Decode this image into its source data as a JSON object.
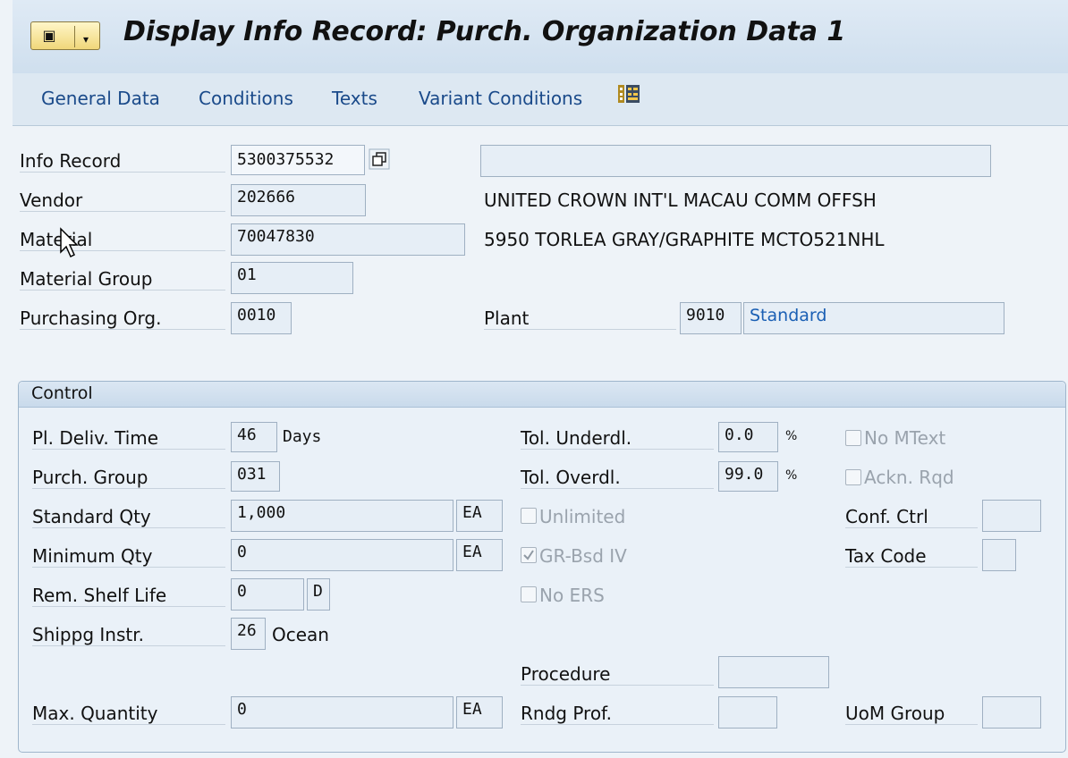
{
  "title": "Display Info Record: Purch. Organization Data 1",
  "toolbar": {
    "items": [
      "General Data",
      "Conditions",
      "Texts",
      "Variant Conditions"
    ],
    "icon": "overview-grid-icon"
  },
  "header": {
    "info_record": {
      "label": "Info Record",
      "value": "5300375532"
    },
    "vendor": {
      "label": "Vendor",
      "value": "202666",
      "name": "UNITED CROWN INT'L MACAU COMM OFFSH"
    },
    "material": {
      "label": "Material",
      "value": "70047830",
      "description": "5950 TORLEA GRAY/GRAPHITE MCTO521NHL"
    },
    "material_group": {
      "label": "Material Group",
      "value": "01"
    },
    "purchasing_org": {
      "label": "Purchasing Org.",
      "value": "0010"
    },
    "plant": {
      "label": "Plant",
      "value": "9010",
      "name": "Standard"
    }
  },
  "control": {
    "title": "Control",
    "pl_deliv_time": {
      "label": "Pl. Deliv. Time",
      "value": "46",
      "unit": "Days"
    },
    "purch_group": {
      "label": "Purch. Group",
      "value": "031"
    },
    "standard_qty": {
      "label": "Standard Qty",
      "value": "1,000",
      "unit": "EA"
    },
    "minimum_qty": {
      "label": "Minimum Qty",
      "value": "0",
      "unit": "EA"
    },
    "rem_shelf_life": {
      "label": "Rem. Shelf Life",
      "value": "0",
      "unit": "D"
    },
    "shippg_instr": {
      "label": "Shippg Instr.",
      "value": "26",
      "text": "Ocean"
    },
    "max_quantity": {
      "label": "Max. Quantity",
      "value": "0",
      "unit": "EA"
    },
    "tol_underdl": {
      "label": "Tol. Underdl.",
      "value": "0.0",
      "unit": "%"
    },
    "tol_overdl": {
      "label": "Tol. Overdl.",
      "value": "99.0",
      "unit": "%"
    },
    "unlimited": {
      "label": "Unlimited",
      "checked": false
    },
    "gr_bsd_iv": {
      "label": "GR-Bsd IV",
      "checked": true
    },
    "no_ers": {
      "label": "No ERS",
      "checked": false
    },
    "no_mtext": {
      "label": "No MText",
      "checked": false
    },
    "ackn_rqd": {
      "label": "Ackn. Rqd",
      "checked": false
    },
    "conf_ctrl": {
      "label": "Conf. Ctrl",
      "value": ""
    },
    "tax_code": {
      "label": "Tax Code",
      "value": ""
    },
    "procedure": {
      "label": "Procedure",
      "value": ""
    },
    "rndg_prof": {
      "label": "Rndg Prof.",
      "value": ""
    },
    "uom_group": {
      "label": "UoM Group",
      "value": ""
    }
  }
}
